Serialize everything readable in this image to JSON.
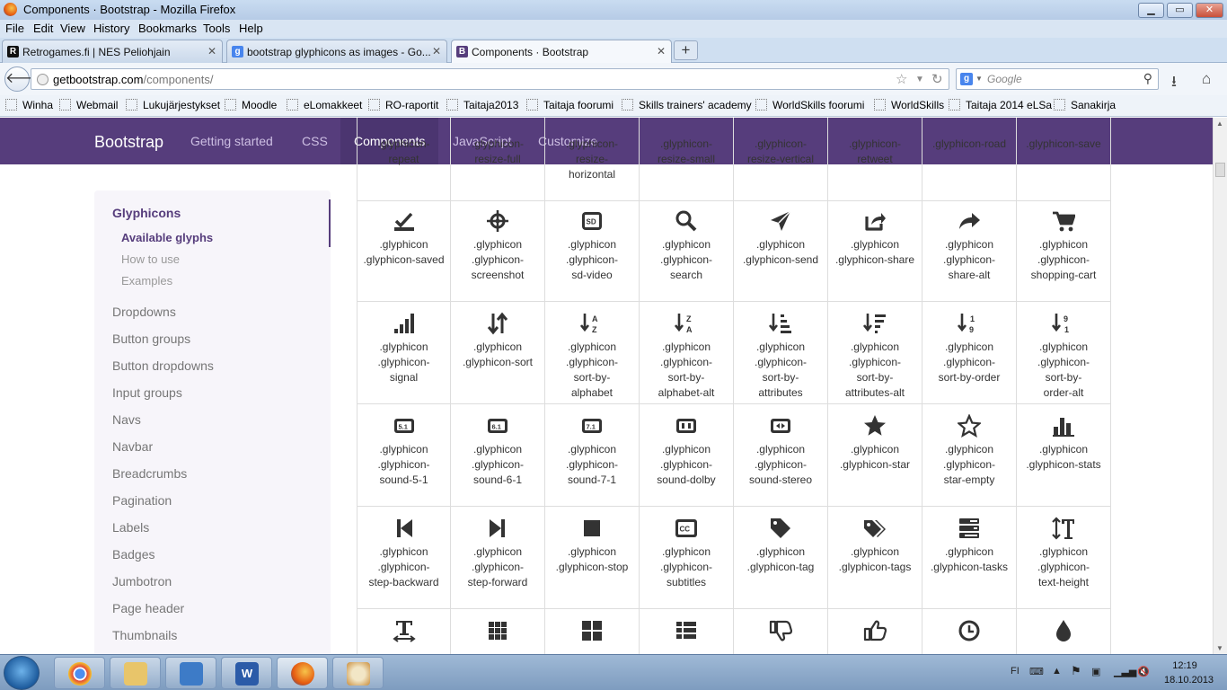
{
  "window": {
    "title": "Components · Bootstrap - Mozilla Firefox",
    "min": "▁",
    "max": "▭",
    "close": "✕"
  },
  "menu": [
    "File",
    "Edit",
    "View",
    "History",
    "Bookmarks",
    "Tools",
    "Help"
  ],
  "tabs": [
    {
      "label": "Retrogames.fi | NES Peliohjain",
      "fav": "R",
      "color": "#111111"
    },
    {
      "label": "bootstrap glyphicons as images - Go...",
      "fav": "g",
      "color": "#4885ed"
    },
    {
      "label": "Components · Bootstrap",
      "fav": "B",
      "color": "#563d7c"
    }
  ],
  "tab_close": "✕",
  "new_tab": "+",
  "url": {
    "host": "getbootstrap.com",
    "path": "/components/"
  },
  "search_placeholder": "Google",
  "bookmarks": [
    "Winha",
    "Webmail",
    "Lukujärjestykset",
    "Moodle",
    "eLomakkeet",
    "RO-raportit",
    "Taitaja2013",
    "Taitaja foorumi",
    "Skills trainers' academy",
    "WorldSkills foorumi",
    "WorldSkills",
    "Taitaja 2014 eLSa",
    "Sanakirja"
  ],
  "site": {
    "brand": "Bootstrap",
    "nav": [
      "Getting started",
      "CSS",
      "Components",
      "JavaScript",
      "Customize"
    ],
    "active_nav": "Components",
    "accent": "#563d7c"
  },
  "sidebar": {
    "heading": "Glyphicons",
    "sub": [
      "Available glyphs",
      "How to use",
      "Examples"
    ],
    "items": [
      "Dropdowns",
      "Button groups",
      "Button dropdowns",
      "Input groups",
      "Navs",
      "Navbar",
      "Breadcrumbs",
      "Pagination",
      "Labels",
      "Badges",
      "Jumbotron",
      "Page header",
      "Thumbnails"
    ]
  },
  "glyph_rows": [
    [
      {
        "icon": "repeat",
        "lines": [
          ".glyphicon-",
          "repeat"
        ]
      },
      {
        "icon": "resize-full",
        "lines": [
          ".glyphicon-",
          "resize-full"
        ]
      },
      {
        "icon": "resize-horizontal",
        "lines": [
          ".glyphicon-",
          "resize-",
          "horizontal"
        ]
      },
      {
        "icon": "resize-small",
        "lines": [
          ".glyphicon-",
          "resize-small"
        ]
      },
      {
        "icon": "resize-vertical",
        "lines": [
          ".glyphicon-",
          "resize-vertical"
        ]
      },
      {
        "icon": "retweet",
        "lines": [
          ".glyphicon-",
          "retweet"
        ]
      },
      {
        "icon": "road",
        "lines": [
          ".glyphicon-road"
        ]
      },
      {
        "icon": "save",
        "lines": [
          ".glyphicon-save"
        ]
      }
    ],
    [
      {
        "icon": "saved",
        "lines": [
          ".glyphicon",
          ".glyphicon-saved"
        ]
      },
      {
        "icon": "screenshot",
        "lines": [
          ".glyphicon",
          ".glyphicon-",
          "screenshot"
        ]
      },
      {
        "icon": "sd-video",
        "lines": [
          ".glyphicon",
          ".glyphicon-",
          "sd-video"
        ]
      },
      {
        "icon": "search",
        "lines": [
          ".glyphicon",
          ".glyphicon-",
          "search"
        ]
      },
      {
        "icon": "send",
        "lines": [
          ".glyphicon",
          ".glyphicon-send"
        ]
      },
      {
        "icon": "share",
        "lines": [
          ".glyphicon",
          ".glyphicon-share"
        ]
      },
      {
        "icon": "share-alt",
        "lines": [
          ".glyphicon",
          ".glyphicon-",
          "share-alt"
        ]
      },
      {
        "icon": "shopping-cart",
        "lines": [
          ".glyphicon",
          ".glyphicon-",
          "shopping-cart"
        ]
      }
    ],
    [
      {
        "icon": "signal",
        "lines": [
          ".glyphicon",
          ".glyphicon-",
          "signal"
        ]
      },
      {
        "icon": "sort",
        "lines": [
          ".glyphicon",
          ".glyphicon-sort"
        ]
      },
      {
        "icon": "sort-by-alphabet",
        "lines": [
          ".glyphicon",
          ".glyphicon-",
          "sort-by-",
          "alphabet"
        ]
      },
      {
        "icon": "sort-by-alphabet-alt",
        "lines": [
          ".glyphicon",
          ".glyphicon-",
          "sort-by-",
          "alphabet-alt"
        ]
      },
      {
        "icon": "sort-by-attributes",
        "lines": [
          ".glyphicon",
          ".glyphicon-",
          "sort-by-",
          "attributes"
        ]
      },
      {
        "icon": "sort-by-attributes-alt",
        "lines": [
          ".glyphicon",
          ".glyphicon-",
          "sort-by-",
          "attributes-alt"
        ]
      },
      {
        "icon": "sort-by-order",
        "lines": [
          ".glyphicon",
          ".glyphicon-",
          "sort-by-order"
        ]
      },
      {
        "icon": "sort-by-order-alt",
        "lines": [
          ".glyphicon",
          ".glyphicon-",
          "sort-by-",
          "order-alt"
        ]
      }
    ],
    [
      {
        "icon": "sound-5-1",
        "lines": [
          ".glyphicon",
          ".glyphicon-",
          "sound-5-1"
        ]
      },
      {
        "icon": "sound-6-1",
        "lines": [
          ".glyphicon",
          ".glyphicon-",
          "sound-6-1"
        ]
      },
      {
        "icon": "sound-7-1",
        "lines": [
          ".glyphicon",
          ".glyphicon-",
          "sound-7-1"
        ]
      },
      {
        "icon": "sound-dolby",
        "lines": [
          ".glyphicon",
          ".glyphicon-",
          "sound-dolby"
        ]
      },
      {
        "icon": "sound-stereo",
        "lines": [
          ".glyphicon",
          ".glyphicon-",
          "sound-stereo"
        ]
      },
      {
        "icon": "star",
        "lines": [
          ".glyphicon",
          ".glyphicon-star"
        ]
      },
      {
        "icon": "star-empty",
        "lines": [
          ".glyphicon",
          ".glyphicon-",
          "star-empty"
        ]
      },
      {
        "icon": "stats",
        "lines": [
          ".glyphicon",
          ".glyphicon-stats"
        ]
      }
    ],
    [
      {
        "icon": "step-backward",
        "lines": [
          ".glyphicon",
          ".glyphicon-",
          "step-backward"
        ]
      },
      {
        "icon": "step-forward",
        "lines": [
          ".glyphicon",
          ".glyphicon-",
          "step-forward"
        ]
      },
      {
        "icon": "stop",
        "lines": [
          ".glyphicon",
          ".glyphicon-stop"
        ]
      },
      {
        "icon": "subtitles",
        "lines": [
          ".glyphicon",
          ".glyphicon-",
          "subtitles"
        ]
      },
      {
        "icon": "tag",
        "lines": [
          ".glyphicon",
          ".glyphicon-tag"
        ]
      },
      {
        "icon": "tags",
        "lines": [
          ".glyphicon",
          ".glyphicon-tags"
        ]
      },
      {
        "icon": "tasks",
        "lines": [
          ".glyphicon",
          ".glyphicon-tasks"
        ]
      },
      {
        "icon": "text-height",
        "lines": [
          ".glyphicon",
          ".glyphicon-",
          "text-height"
        ]
      }
    ],
    [
      {
        "icon": "text-width",
        "lines": []
      },
      {
        "icon": "th",
        "lines": []
      },
      {
        "icon": "th-large",
        "lines": []
      },
      {
        "icon": "th-list",
        "lines": []
      },
      {
        "icon": "thumbs-down",
        "lines": []
      },
      {
        "icon": "thumbs-up",
        "lines": []
      },
      {
        "icon": "time",
        "lines": []
      },
      {
        "icon": "tint",
        "lines": []
      }
    ]
  ],
  "taskbar": {
    "apps": [
      "chrome",
      "explorer",
      "virtualbox",
      "word",
      "firefox",
      "paint"
    ],
    "lang": "FI",
    "time": "12:19",
    "date": "18.10.2013"
  }
}
